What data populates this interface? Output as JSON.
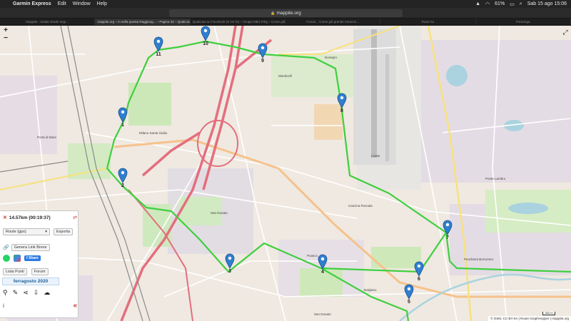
{
  "menubar": {
    "app_name": "Garmin Express",
    "menus": [
      "Edit",
      "Window",
      "Help"
    ],
    "battery": "61%",
    "datetime": "Sab 15 ago  15:06"
  },
  "browser": {
    "url": "mappite.org",
    "tabs": [
      "Mappite - strade strade segr...",
      "mappite.org – In sella questa Raggiung... – Pagina 33 – Qualcosa...",
      "Qualcosa su Facebook (6 ore fa) – Gruppi MB1-Frbg – Come già grande Amazon",
      "Forum... Come già grande Amazon...",
      "Rand Xu",
      "Paraonga"
    ],
    "active_tab": 1
  },
  "map": {
    "zoom_in": "+",
    "zoom_out": "−",
    "fullscreen_icon": "⤢",
    "attribution": "© OSM, CC-BY-SA | Route GraphHopper | mappite.org",
    "scale": "300 m",
    "route_color": "#3fcf3f",
    "waypoints": [
      {
        "label": "1"
      },
      {
        "label": "2"
      },
      {
        "label": "3"
      },
      {
        "label": "4"
      },
      {
        "label": "5"
      },
      {
        "label": "6"
      },
      {
        "label": "7"
      },
      {
        "label": "8"
      },
      {
        "label": "9"
      },
      {
        "label": "10"
      },
      {
        "label": "11"
      }
    ],
    "places": [
      "Porta di Mare",
      "Milano Santa Giulia",
      "San Donato",
      "Poasco",
      "Cascina Roscala",
      "Bolgiano",
      "Monticelli",
      "Linate",
      "Novegro",
      "Ponte Lambro",
      "Peschiera Borromeo",
      "San Donato"
    ]
  },
  "panel": {
    "distance": "14.57km (00:19:37)",
    "route_select": "Route (gpx)",
    "export_button": "Esporta",
    "short_link_button": "Genera Link Breve",
    "share_button": "Share",
    "list_points_button": "Lista Punti",
    "forum_button": "Forum",
    "route_name": "ferragosto 2020",
    "collapse_icon": "«"
  }
}
